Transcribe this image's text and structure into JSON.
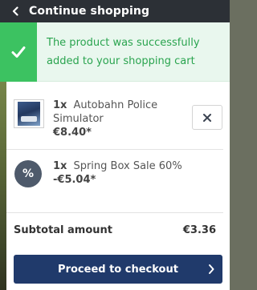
{
  "header": {
    "title": "Continue shopping"
  },
  "notification": {
    "message": "The product was successfully added to your shopping cart"
  },
  "cart": {
    "items": [
      {
        "qty": "1x",
        "name": "Autobahn Police Simulator",
        "price": "€8.40*"
      },
      {
        "qty": "1x",
        "name": "Spring Box Sale 60%",
        "price": "-€5.04*",
        "badge": "%"
      }
    ],
    "subtotal_label": "Subtotal amount",
    "subtotal_value": "€3.36"
  },
  "actions": {
    "checkout_label": "Proceed to checkout"
  },
  "colors": {
    "header_bg": "#2c3036",
    "success_bg": "#e9f7ee",
    "success_accent": "#3cc261",
    "success_text": "#2aa44f",
    "checkout_bg": "#203a6b",
    "badge_bg": "#4e5a6b"
  },
  "icons": [
    "chevron-left-icon",
    "checkmark-icon",
    "close-icon",
    "percent-icon",
    "chevron-right-icon"
  ]
}
